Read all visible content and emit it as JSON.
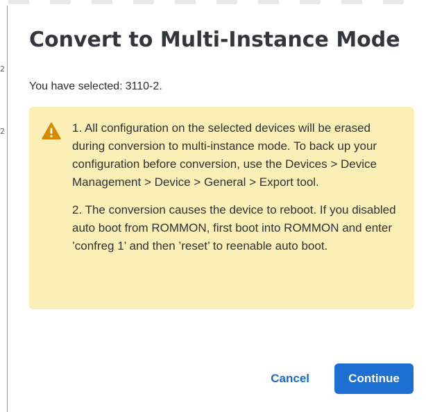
{
  "dialog": {
    "title": "Convert to Multi-Instance Mode",
    "selected_label": "You have selected:",
    "selected_value": "3110-2.",
    "warning": {
      "icon": "warning-triangle-icon",
      "icon_color": "#d68a00",
      "background_color": "#fbefb8",
      "paragraph_1": "1. All configuration on the selected devices will be erased during conversion to multi-instance mode. To back up your configuration before conversion, use the Devices > Device Management > Device > General > Export tool.",
      "paragraph_2": "2. The conversion causes the device to reboot. If you disabled auto boot from ROMMON, first boot into ROMMON and enter ’confreg 1’ and then ’reset’ to reenable auto boot."
    },
    "buttons": {
      "cancel_label": "Cancel",
      "continue_label": "Continue"
    },
    "colors": {
      "primary": "#1d6fd1",
      "link": "#1b6ac9"
    }
  }
}
